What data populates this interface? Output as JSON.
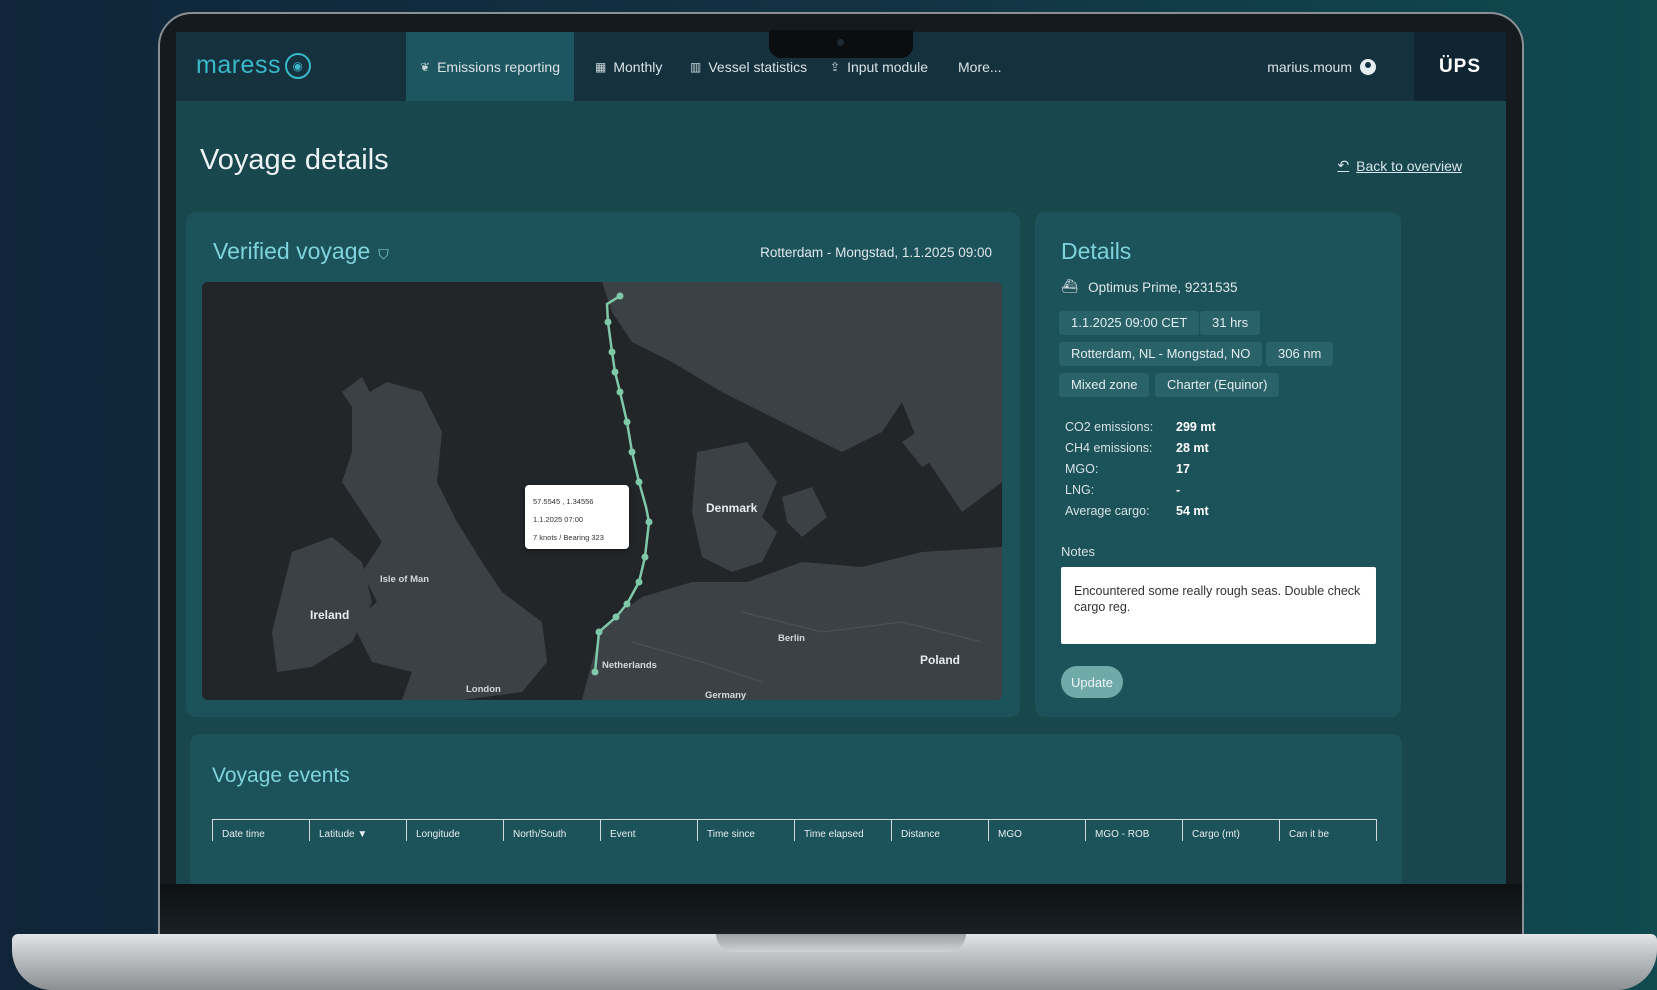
{
  "nav": {
    "logo": "maress",
    "items": [
      {
        "label": "Emissions reporting",
        "icon": "leaf-icon",
        "glyph": "❦",
        "active": true
      },
      {
        "label": "Monthly",
        "icon": "calendar-icon",
        "glyph": "▦",
        "active": false
      },
      {
        "label": "Vessel statistics",
        "icon": "bar-chart-icon",
        "glyph": "▥",
        "active": false
      },
      {
        "label": "Input module",
        "icon": "upload-icon",
        "glyph": "⇪",
        "active": false
      },
      {
        "label": "More...",
        "icon": "",
        "glyph": "",
        "active": false
      }
    ],
    "user": "marius.moum",
    "brand": "ÜPS"
  },
  "page": {
    "title": "Voyage details",
    "back_link": "Back to overview"
  },
  "voyage": {
    "title": "Verified voyage",
    "route_label": "Rotterdam - Mongstad, 1.1.2025 09:00",
    "map_labels": {
      "denmark": "Denmark",
      "ireland": "Ireland",
      "isle_of_man": "Isle of Man",
      "netherlands": "Netherlands",
      "london": "London",
      "berlin": "Berlin",
      "poland": "Poland",
      "germany": "Germany"
    },
    "tooltip": {
      "coords": "57.5545 , 1.34556",
      "time": "1.1.2025 07:00",
      "speed": "7 knots / Bearing 323"
    }
  },
  "details": {
    "title": "Details",
    "ship": "Optimus Prime, 9231535",
    "chips": {
      "datetime": "1.1.2025 09:00 CET",
      "duration": "31 hrs",
      "route": "Rotterdam, NL - Mongstad, NO",
      "distance": "306 nm",
      "zone": "Mixed zone",
      "charter": "Charter (Equinor)"
    },
    "stats": [
      {
        "label": "CO2 emissions:",
        "value": "299 mt"
      },
      {
        "label": "CH4 emissions:",
        "value": "28 mt"
      },
      {
        "label": "MGO:",
        "value": "17"
      },
      {
        "label": "LNG:",
        "value": "-"
      },
      {
        "label": "Average cargo:",
        "value": "54 mt"
      }
    ],
    "notes_label": "Notes",
    "notes_text": "Encountered some really rough seas. Double check cargo reg.",
    "update_label": "Update"
  },
  "events": {
    "title": "Voyage events",
    "columns": [
      "Date time",
      "Latitude ▼",
      "Longitude",
      "North/South",
      "Event",
      "Time since",
      "Time elapsed",
      "Distance",
      "MGO",
      "MGO - ROB",
      "Cargo (mt)",
      "Can it be"
    ]
  }
}
